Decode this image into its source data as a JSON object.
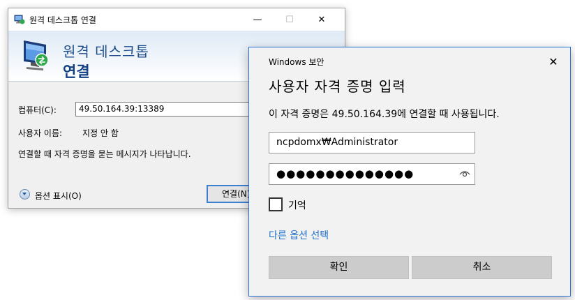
{
  "rdp_window": {
    "title": "원격 데스크톱 연결",
    "window_buttons": {
      "minimize": "—",
      "maximize": "☐",
      "close": "✕"
    },
    "banner": {
      "line1": "원격 데스크톱",
      "line2": "연결"
    },
    "computer_label": "컴퓨터(C):",
    "computer_value": "49.50.164.39:13389",
    "username_label": "사용자 이름:",
    "username_value": "지정 안 함",
    "notice": "연결할 때 자격 증명을 묻는 메시지가 나타납니다.",
    "options_label": "옵션 표시(O)",
    "connect_label": "연결(N)"
  },
  "security_dialog": {
    "title": "Windows 보안",
    "close": "✕",
    "heading": "사용자 자격 증명 입력",
    "description": "이 자격 증명은 49.50.164.39에 연결할 때 사용됩니다.",
    "username_value": "ncpdomx₩Administrator",
    "password_mask": "●●●●●●●●●●●●●●",
    "remember_label": "기억",
    "remember_checked": false,
    "more_choices_link": "다른 옵션 선택",
    "ok_label": "확인",
    "cancel_label": "취소",
    "link_color": "#1f6fc8",
    "border_color": "#2b72d8"
  }
}
